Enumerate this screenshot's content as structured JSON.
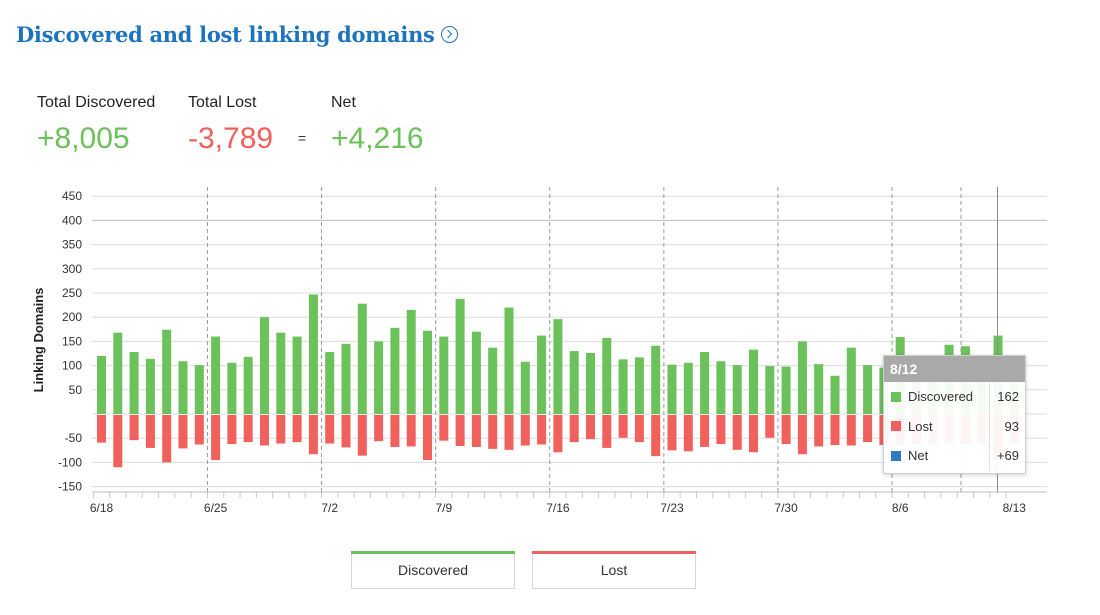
{
  "header": {
    "title": "Discovered and lost linking domains"
  },
  "summary": {
    "discovered_label": "Total Discovered",
    "discovered_value": "+8,005",
    "lost_label": "Total Lost",
    "lost_value": "-3,789",
    "equals": "=",
    "net_label": "Net",
    "net_value": "+4,216"
  },
  "colors": {
    "discovered": "#6bc15a",
    "lost": "#f0605d",
    "net": "#2f7bbd",
    "title": "#1e73be"
  },
  "tooltip": {
    "date": "8/12",
    "rows": [
      {
        "name": "Discovered",
        "value": "162"
      },
      {
        "name": "Lost",
        "value": "93"
      },
      {
        "name": "Net",
        "value": "+69"
      }
    ]
  },
  "legend": {
    "discovered": "Discovered",
    "lost": "Lost"
  },
  "chart_data": {
    "type": "bar",
    "ylabel": "Linking Domains",
    "xlabel": "",
    "ylim": [
      -150,
      450
    ],
    "yticks": [
      450,
      400,
      350,
      300,
      250,
      200,
      150,
      100,
      50,
      -50,
      -100,
      -150
    ],
    "xtick_labels": [
      "6/18",
      "6/25",
      "7/2",
      "7/9",
      "7/16",
      "7/23",
      "7/30",
      "8/6",
      "8/13"
    ],
    "grid": true,
    "legend_position": "bottom",
    "categories": [
      "6/18",
      "6/19",
      "6/20",
      "6/21",
      "6/22",
      "6/23",
      "6/24",
      "6/25",
      "6/26",
      "6/27",
      "6/28",
      "6/29",
      "6/30",
      "7/1",
      "7/2",
      "7/3",
      "7/4",
      "7/5",
      "7/6",
      "7/7",
      "7/8",
      "7/9",
      "7/10",
      "7/11",
      "7/12",
      "7/13",
      "7/14",
      "7/15",
      "7/16",
      "7/17",
      "7/18",
      "7/19",
      "7/20",
      "7/21",
      "7/22",
      "7/23",
      "7/24",
      "7/25",
      "7/26",
      "7/27",
      "7/28",
      "7/29",
      "7/30",
      "7/31",
      "8/1",
      "8/2",
      "8/3",
      "8/4",
      "8/5",
      "8/6",
      "8/7",
      "8/8",
      "8/9",
      "8/10",
      "8/11",
      "8/12",
      "8/13"
    ],
    "series": [
      {
        "name": "Discovered",
        "values": [
          120,
          168,
          128,
          114,
          174,
          109,
          101,
          160,
          106,
          118,
          200,
          168,
          160,
          247,
          128,
          145,
          228,
          150,
          178,
          215,
          172,
          160,
          238,
          170,
          137,
          220,
          108,
          162,
          196,
          130,
          126,
          157,
          113,
          117,
          141,
          102,
          106,
          128,
          109,
          101,
          133,
          99,
          98,
          150,
          103,
          79,
          137,
          101,
          96,
          159,
          110,
          110,
          143,
          140,
          110,
          162,
          118
        ]
      },
      {
        "name": "Lost",
        "values": [
          -57,
          -108,
          -52,
          -68,
          -98,
          -69,
          -61,
          -93,
          -60,
          -56,
          -63,
          -59,
          -56,
          -81,
          -59,
          -67,
          -84,
          -54,
          -66,
          -65,
          -93,
          -53,
          -64,
          -66,
          -70,
          -72,
          -63,
          -61,
          -77,
          -56,
          -50,
          -68,
          -47,
          -56,
          -85,
          -73,
          -75,
          -66,
          -60,
          -72,
          -77,
          -47,
          -60,
          -81,
          -65,
          -62,
          -63,
          -56,
          -62,
          -62,
          -60,
          -60,
          -58,
          -60,
          -58,
          -93,
          -58
        ]
      }
    ]
  }
}
